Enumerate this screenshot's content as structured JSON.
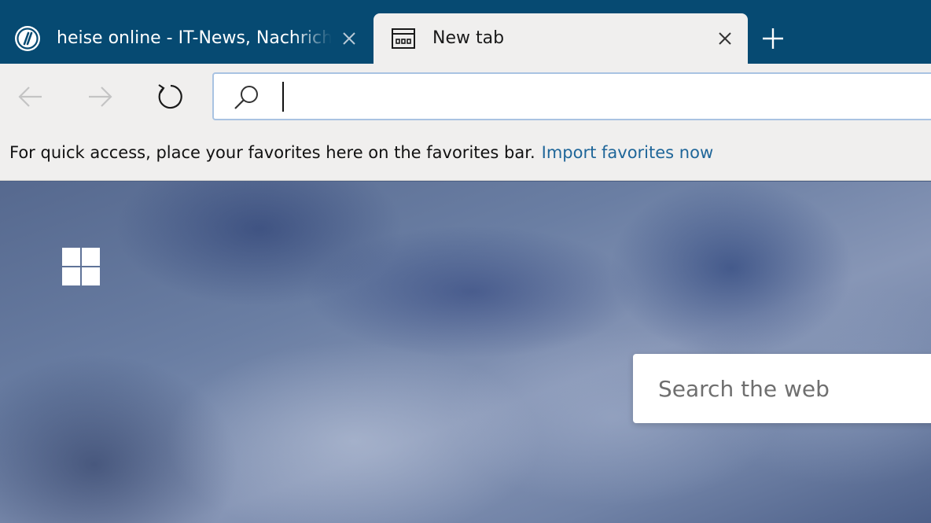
{
  "tabs": [
    {
      "title": "heise online - IT-News, Nachrichten",
      "favicon": "heise-logo-icon",
      "active": false
    },
    {
      "title": "New tab",
      "favicon": "new-tab-page-icon",
      "active": true
    }
  ],
  "tabstrip": {
    "new_tab_icon": "plus-icon",
    "background": "#064a72"
  },
  "navbar": {
    "back_icon": "arrow-left-icon",
    "forward_icon": "arrow-right-icon",
    "refresh_icon": "refresh-icon",
    "address": {
      "value": "",
      "search_icon": "search-icon"
    }
  },
  "favorites_bar": {
    "message": "For quick access, place your favorites here on the favorites bar.",
    "import_link": "Import favorites now",
    "link_color": "#1f6699"
  },
  "newtab": {
    "logo": "windows-logo-icon",
    "search_placeholder": "Search the web"
  }
}
